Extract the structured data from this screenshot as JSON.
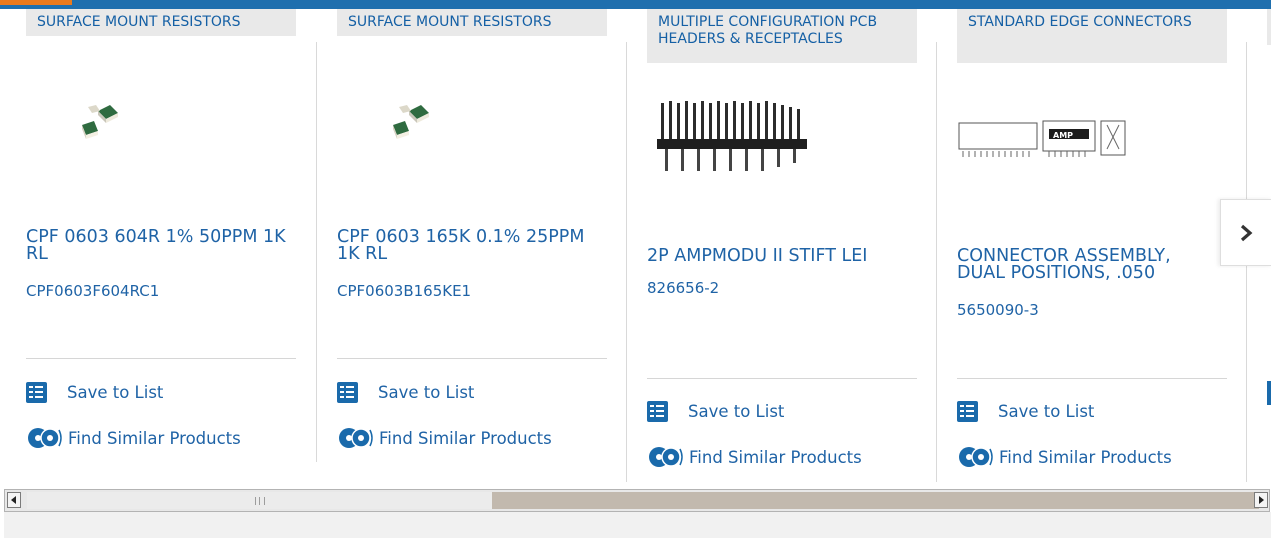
{
  "carousel": {
    "products": [
      {
        "category": "SURFACE MOUNT RESISTORS",
        "title": "CPF 0603 604R 1% 50PPM 1K RL",
        "part_number": "CPF0603F604RC1",
        "save_label": "Save to List",
        "similar_label": "Find Similar Products",
        "image_icon": "smd-resistors-image"
      },
      {
        "category": "SURFACE MOUNT RESISTORS",
        "title": "CPF 0603 165K 0.1% 25PPM 1K RL",
        "part_number": "CPF0603B165KE1",
        "save_label": "Save to List",
        "similar_label": "Find Similar Products",
        "image_icon": "smd-resistors-image"
      },
      {
        "category": "MULTIPLE CONFIGURATION PCB HEADERS & RECEPTACLES",
        "title": "2P AMPMODU II STIFT LEI",
        "part_number": "826656-2",
        "save_label": "Save to List",
        "similar_label": "Find Similar Products",
        "image_icon": "pin-header-image"
      },
      {
        "category": "STANDARD EDGE CONNECTORS",
        "title": "CONNECTOR ASSEMBLY, DUAL POSITIONS, .050",
        "part_number": "5650090-3",
        "save_label": "Save to List",
        "similar_label": "Find Similar Products",
        "image_icon": "edge-connector-image"
      }
    ],
    "next_icon": "chevron-right-icon"
  },
  "scrollbar": {
    "left_icon": "arrow-left-icon",
    "right_icon": "arrow-right-icon"
  },
  "colors": {
    "brand_blue": "#1f63a6",
    "accent_orange": "#ea7a1d",
    "top_bar": "#1f6fae"
  }
}
